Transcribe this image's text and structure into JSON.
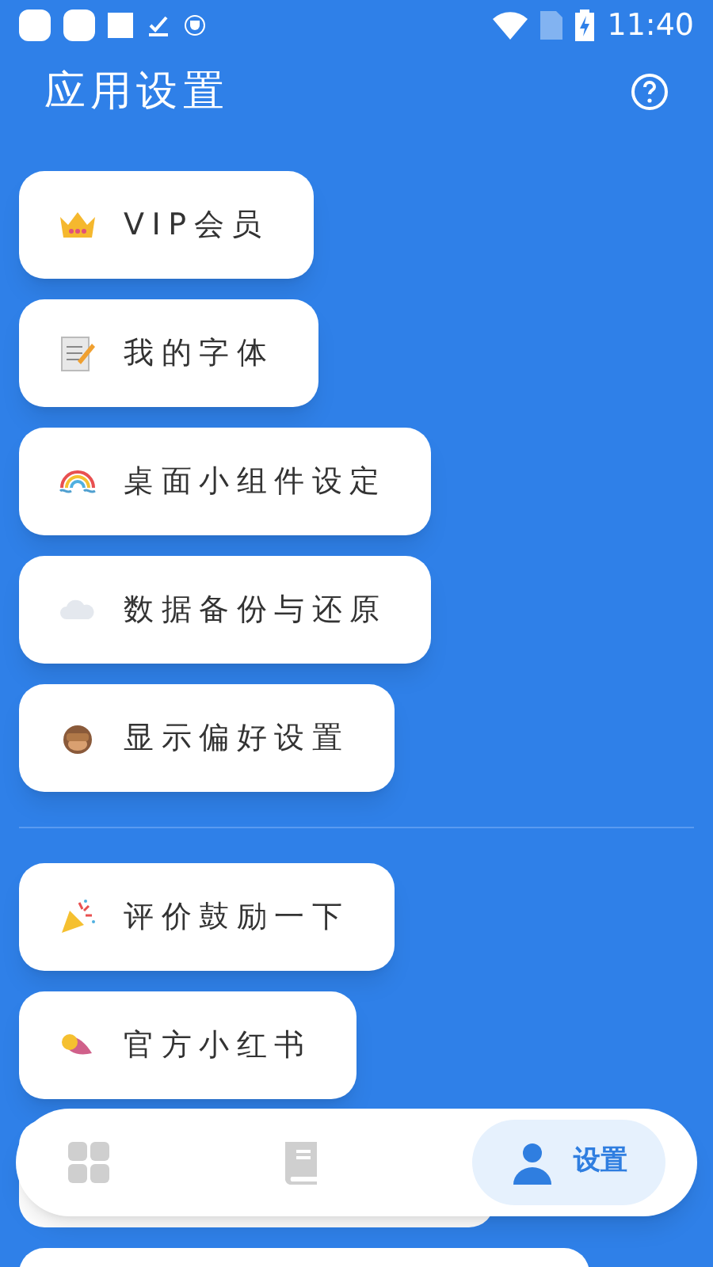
{
  "status_bar": {
    "time": "11:40"
  },
  "header": {
    "title": "应用设置"
  },
  "sections": [
    {
      "items": [
        {
          "kind": "crown",
          "label": "VIP会员"
        },
        {
          "kind": "memo",
          "label": "我的字体"
        },
        {
          "kind": "rainbow",
          "label": "桌面小组件设定"
        },
        {
          "kind": "cloud",
          "label": "数据备份与还原"
        },
        {
          "kind": "monkey",
          "label": "显示偏好设置"
        }
      ]
    },
    {
      "items": [
        {
          "kind": "party",
          "label": "评价鼓励一下"
        },
        {
          "kind": "potato",
          "label": "官方小红书"
        }
      ]
    }
  ],
  "bottom_nav": [
    {
      "kind": "grid",
      "selected": false
    },
    {
      "kind": "book",
      "selected": false
    },
    {
      "kind": "person",
      "label": "设置",
      "selected": true
    }
  ]
}
